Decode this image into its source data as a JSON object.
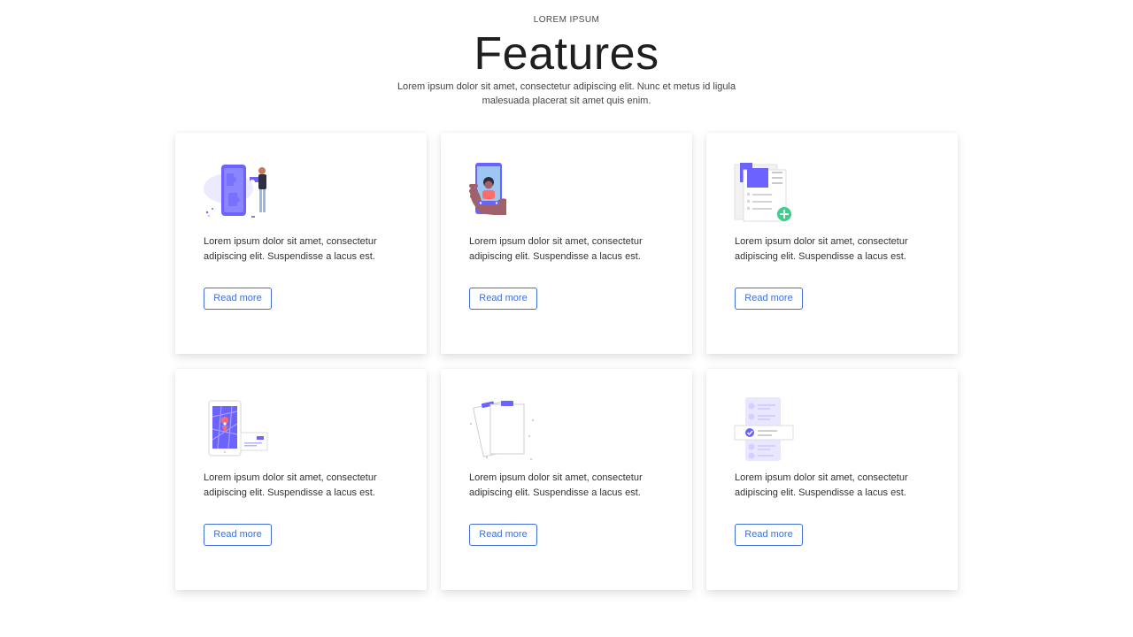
{
  "header": {
    "eyebrow": "LOREM IPSUM",
    "title": "Features",
    "subtitle": "Lorem ipsum dolor sit amet, consectetur adipiscing elit. Nunc et metus id ligula malesuada placerat sit amet quis enim."
  },
  "colors": {
    "accent": "#3f6fd6",
    "illustration_primary": "#6c63ff",
    "illustration_success": "#3ecf8e",
    "illustration_marker": "#ff6b6b"
  },
  "cards": [
    {
      "illustration": "puzzle-phone-illustration",
      "text": "Lorem ipsum dolor sit amet, consectetur adipiscing elit. Suspendisse a lacus est.",
      "button": "Read more"
    },
    {
      "illustration": "selfie-phone-illustration",
      "text": "Lorem ipsum dolor sit amet, consectetur adipiscing elit. Suspendisse a lacus est.",
      "button": "Read more"
    },
    {
      "illustration": "add-document-illustration",
      "text": "Lorem ipsum dolor sit amet, consectetur adipiscing elit. Suspendisse a lacus est.",
      "button": "Read more"
    },
    {
      "illustration": "map-location-illustration",
      "text": "Lorem ipsum dolor sit amet, consectetur adipiscing elit. Suspendisse a lacus est.",
      "button": "Read more"
    },
    {
      "illustration": "clipboard-illustration",
      "text": "Lorem ipsum dolor sit amet, consectetur adipiscing elit. Suspendisse a lacus est.",
      "button": "Read more"
    },
    {
      "illustration": "checklist-illustration",
      "text": "Lorem ipsum dolor sit amet, consectetur adipiscing elit. Suspendisse a lacus est.",
      "button": "Read more"
    }
  ]
}
